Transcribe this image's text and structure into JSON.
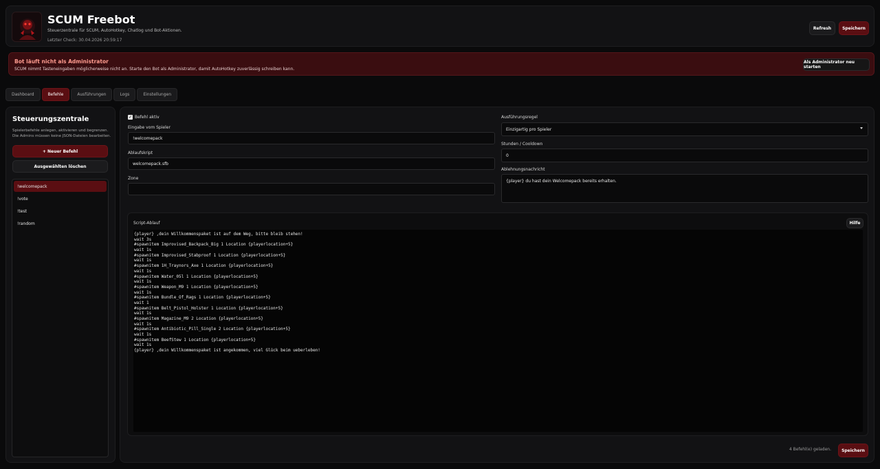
{
  "app": {
    "title": "SCUM Freebot",
    "subtitle": "Steuerzentrale für SCUM, AutoHotkey, Chatlog und Bot-Aktionen.",
    "last_check": "Letzter Check: 30.04.2026 20:59:17",
    "refresh_label": "Refresh",
    "save_label": "Speichern"
  },
  "alert": {
    "title": "Bot läuft nicht als Administrator",
    "text": "SCUM nimmt Tasteneingaben möglicherweise nicht an. Starte den Bot als Administrator, damit AutoHotkey zuverlässig schreiben kann.",
    "button_label": "Als Administrator neu starten"
  },
  "tabs": [
    {
      "label": "Dashboard",
      "active": false
    },
    {
      "label": "Befehle",
      "active": true
    },
    {
      "label": "Ausführungen",
      "active": false
    },
    {
      "label": "Logs",
      "active": false
    },
    {
      "label": "Einstellungen",
      "active": false
    }
  ],
  "sidebar": {
    "title": "Steuerungszentrale",
    "description": "Spielerbefehle anlegen, aktivieren und begrenzen. Die Admins müssen keine JSON-Dateien bearbeiten.",
    "new_button": "+ Neuer Befehl",
    "delete_button": "Ausgewählten löschen",
    "commands": [
      "!welcomepack",
      "!vote",
      "!test",
      "!random"
    ],
    "selected_index": 0
  },
  "form": {
    "active_label": "Befehl aktiv",
    "active_checked": true,
    "input_label": "Eingabe vom Spieler",
    "input_value": "!welcomepack",
    "script_label": "Ablaufskript",
    "script_value": "welcomepack.sfb",
    "zone_label": "Zone",
    "zone_value": "",
    "rule_label": "Ausführungsregel",
    "rule_value": "Einzigartig pro Spieler",
    "cooldown_label": "Stunden / Cooldown",
    "cooldown_value": "0",
    "reject_label": "Ablehnungsnachricht",
    "reject_value": "{player} du hast dein Welcomepack bereits erhalten."
  },
  "script": {
    "label": "Script-Ablauf",
    "help_label": "Hilfe",
    "content": "{player} ,dein Willkommenspaket ist auf dem Weg, bitte bleib stehen!\nwait 3s\n#spawnitem Improvised_Backpack_Big 1 Location {playerlocation+5}\nwait 1s\n#spawnitem Improvised_Stabproof 1 Location {playerlocation+5}\nwait 1s\n#spawnitem 1H_Traynors_Axe 1 Location {playerlocation+5}\nwait 1s\n#spawnitem Water_05l 1 Location {playerlocation+5}\nwait 1s\n#spawnitem Weapon_M9 1 Location {playerlocation+5}\nwait 1s\n#spawnitem Bundle_Of_Rags 1 Location {playerlocation+5}\nwait 1\n#spawnitem Belt_Pistol_Holster 1 Location {playerlocation+5}\nwait 1s\n#spawnitem Magazine_M9 2 Location {playerlocation+5}\nwait 1s\n#spawnitem Antibiotic_Pill_Single 2 Location {playerlocation+5}\nwait 1s\n#spawnitem BeefStew 1 Location {playerlocation+5}\nwait 1s\n{player} ,dein Willkommenspaket ist angekommen, viel Glück beim ueberleben!"
  },
  "footer": {
    "status": "4 Befehl(e) geladen.",
    "save_label": "Speichern"
  }
}
